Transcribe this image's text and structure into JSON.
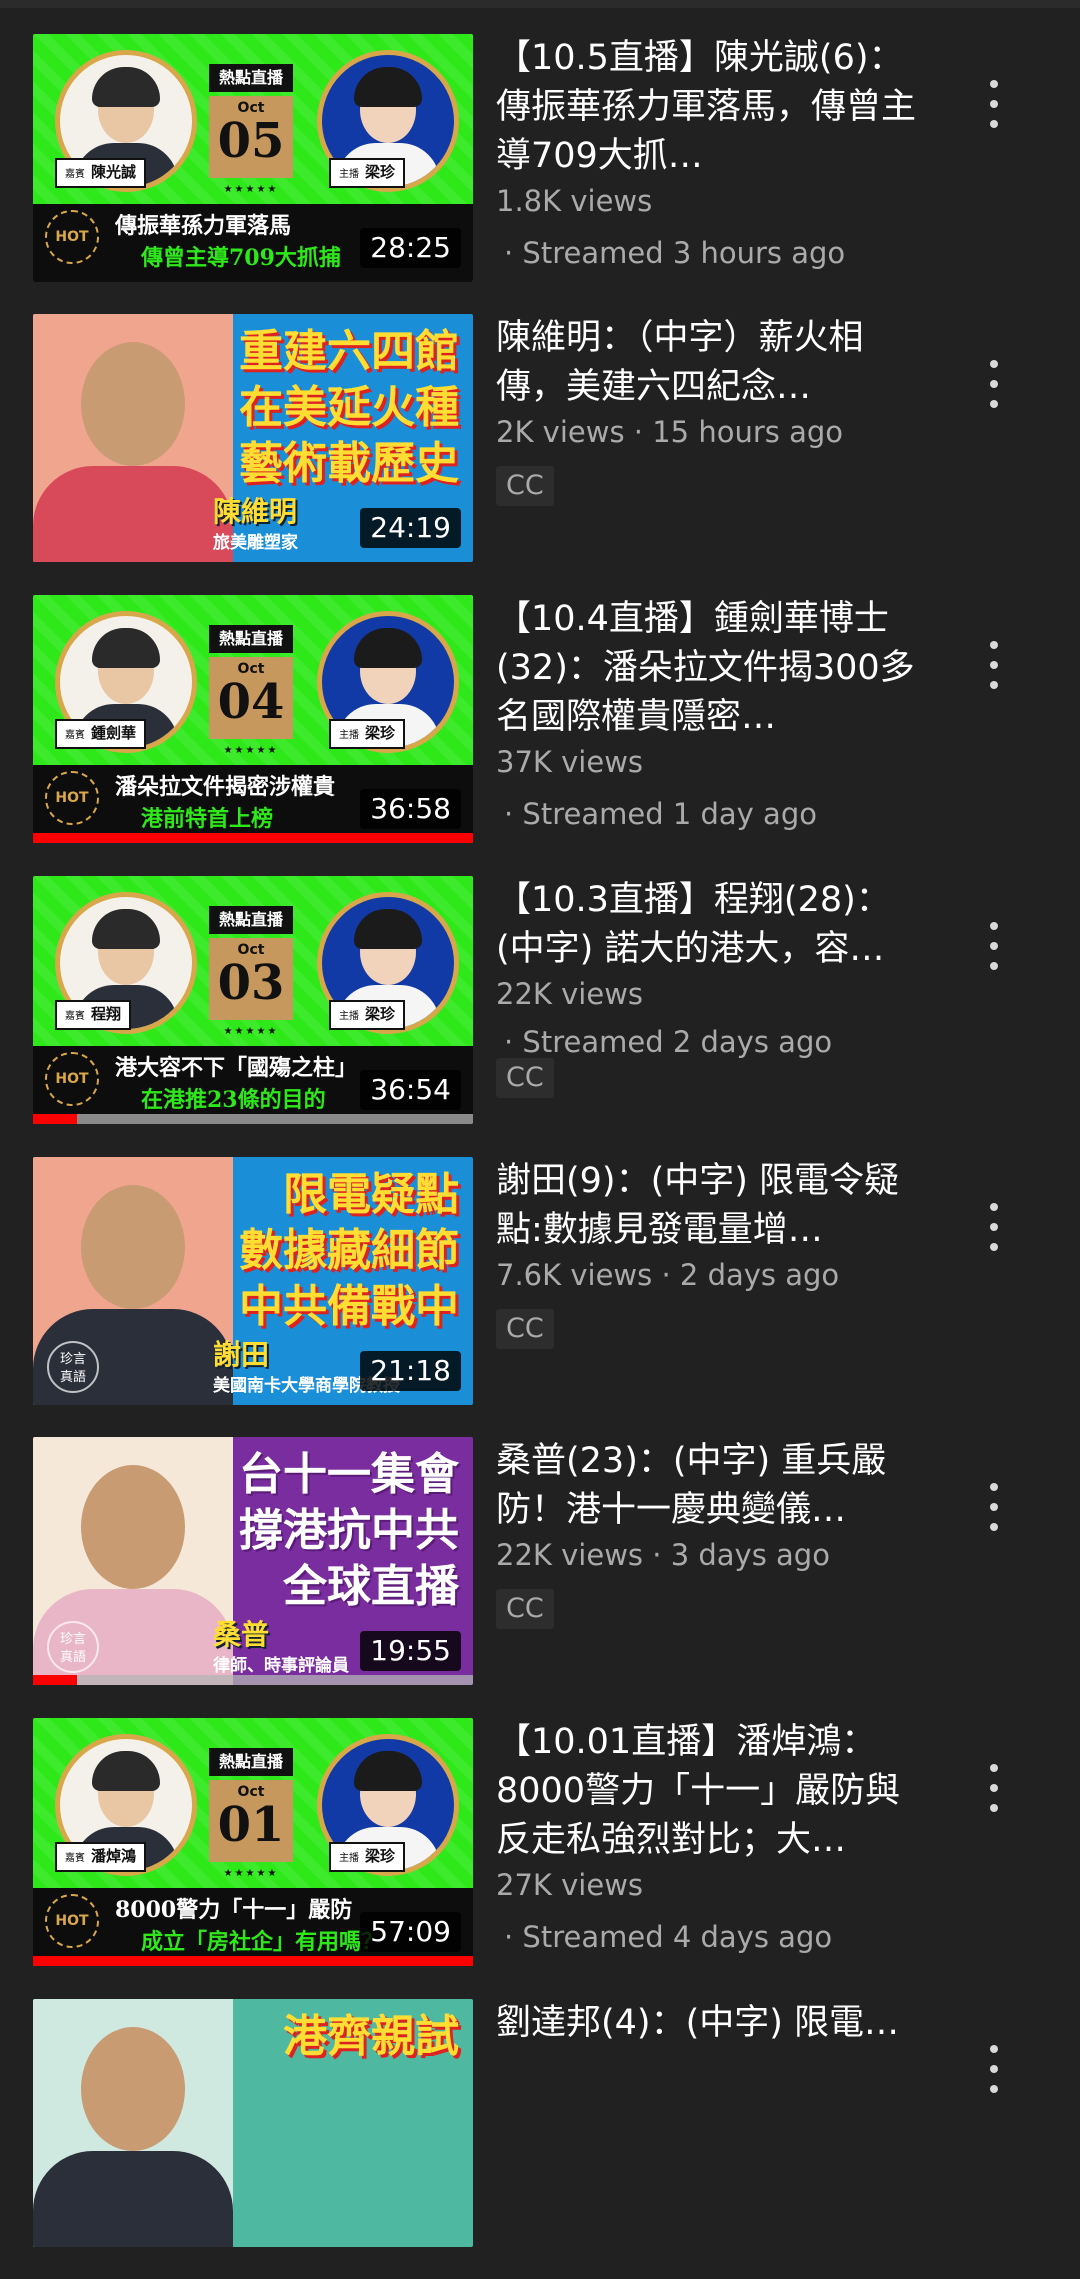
{
  "videos": [
    {
      "title": "【10.5直播】陳光誠(6)：傳振華孫力軍落馬，傳曾主導709大抓…",
      "views": "1.8K views",
      "age": "",
      "streamed": "· Streamed 3 hours ago",
      "cc": "",
      "duration": "28:25",
      "thumb": {
        "style": "live",
        "hot_tag": "熱點直播",
        "month": "Oct",
        "day": "05",
        "stars": "★★★★★",
        "guest_tag": "嘉賓",
        "guest": "陳光誠",
        "host_tag": "主播",
        "host": "梁珍",
        "badge": "HOT",
        "line1": "傳振華孫力軍落馬",
        "line2": "傳曾主導709大抓捕"
      },
      "progress": 0
    },
    {
      "title": "陳維明：（中字）薪火相傳，美建六四紀念…",
      "views": "2K views",
      "age": "15 hours ago",
      "streamed": "",
      "cc": "CC",
      "duration": "24:19",
      "thumb": {
        "style": "photo",
        "headline": "重建六四館\n在美延火種\n藝術載歷史",
        "guest": "陳維明",
        "guest_sub": "旅美雕塑家"
      },
      "progress": 0
    },
    {
      "title": "【10.4直播】鍾劍華博士(32)：潘朵拉文件揭300多名國際權貴隱密…",
      "views": "37K views",
      "age": "",
      "streamed": "· Streamed 1 day ago",
      "cc": "",
      "duration": "36:58",
      "thumb": {
        "style": "live",
        "hot_tag": "熱點直播",
        "month": "Oct",
        "day": "04",
        "stars": "★★★★★",
        "guest_tag": "嘉賓",
        "guest": "鍾劍華",
        "host_tag": "主播",
        "host": "梁珍",
        "badge": "HOT",
        "line1": "潘朵拉文件揭密涉權貴",
        "line2": "港前特首上榜"
      },
      "progress": 1.0
    },
    {
      "title": "【10.3直播】程翔(28)：(中字) 諾大的港大，容…",
      "views": "22K views",
      "age": "",
      "streamed": "· Streamed 2 days ago",
      "cc": "CC",
      "duration": "36:54",
      "thumb": {
        "style": "live",
        "hot_tag": "熱點直播",
        "month": "Oct",
        "day": "03",
        "stars": "★★★★★",
        "guest_tag": "嘉賓",
        "guest": "程翔",
        "host_tag": "主播",
        "host": "梁珍",
        "badge": "HOT",
        "line1": "港大容不下「國殤之柱」",
        "line2": "在港推23條的目的"
      },
      "progress": 0.1
    },
    {
      "title": "謝田(9)：(中字) 限電令疑點:數據見發電量增…",
      "views": "7.6K views",
      "age": "2 days ago",
      "streamed": "",
      "cc": "CC",
      "duration": "21:18",
      "thumb": {
        "style": "photo",
        "headline": "限電疑點\n數據藏細節\n中共備戰中",
        "guest": "謝田",
        "guest_sub": "美國南卡大學商學院教授",
        "quote": "珍言\n真語"
      },
      "progress": 0
    },
    {
      "title": "桑普(23)：(中字) 重兵嚴防！港十一慶典變儀…",
      "views": "22K views",
      "age": "3 days ago",
      "streamed": "",
      "cc": "CC",
      "duration": "19:55",
      "thumb": {
        "style": "photo-purple",
        "headline": "台十一集會\n撐港抗中共\n全球直播",
        "guest": "桑普",
        "guest_sub": "律師、時事評論員",
        "quote": "珍言\n真語"
      },
      "progress": 0.1
    },
    {
      "title": "【10.01直播】潘焯鴻：8000警力「十一」嚴防與反走私強烈對比；大…",
      "views": "27K views",
      "age": "",
      "streamed": "· Streamed 4 days ago",
      "cc": "",
      "duration": "57:09",
      "thumb": {
        "style": "live",
        "hot_tag": "熱點直播",
        "month": "Oct",
        "day": "01",
        "stars": "★★★★★",
        "guest_tag": "嘉賓",
        "guest": "潘焯鴻",
        "host_tag": "主播",
        "host": "梁珍",
        "badge": "HOT",
        "line1": "8000警力「十一」嚴防",
        "line2": "成立「房社企」有用嗎？"
      },
      "progress": 1.0
    },
    {
      "title": "劉達邦(4)：(中字) 限電…",
      "views": "",
      "age": "",
      "streamed": "",
      "cc": "",
      "duration": "",
      "thumb": {
        "style": "photo-teal",
        "headline": "港齊親試"
      },
      "progress": 0
    }
  ]
}
